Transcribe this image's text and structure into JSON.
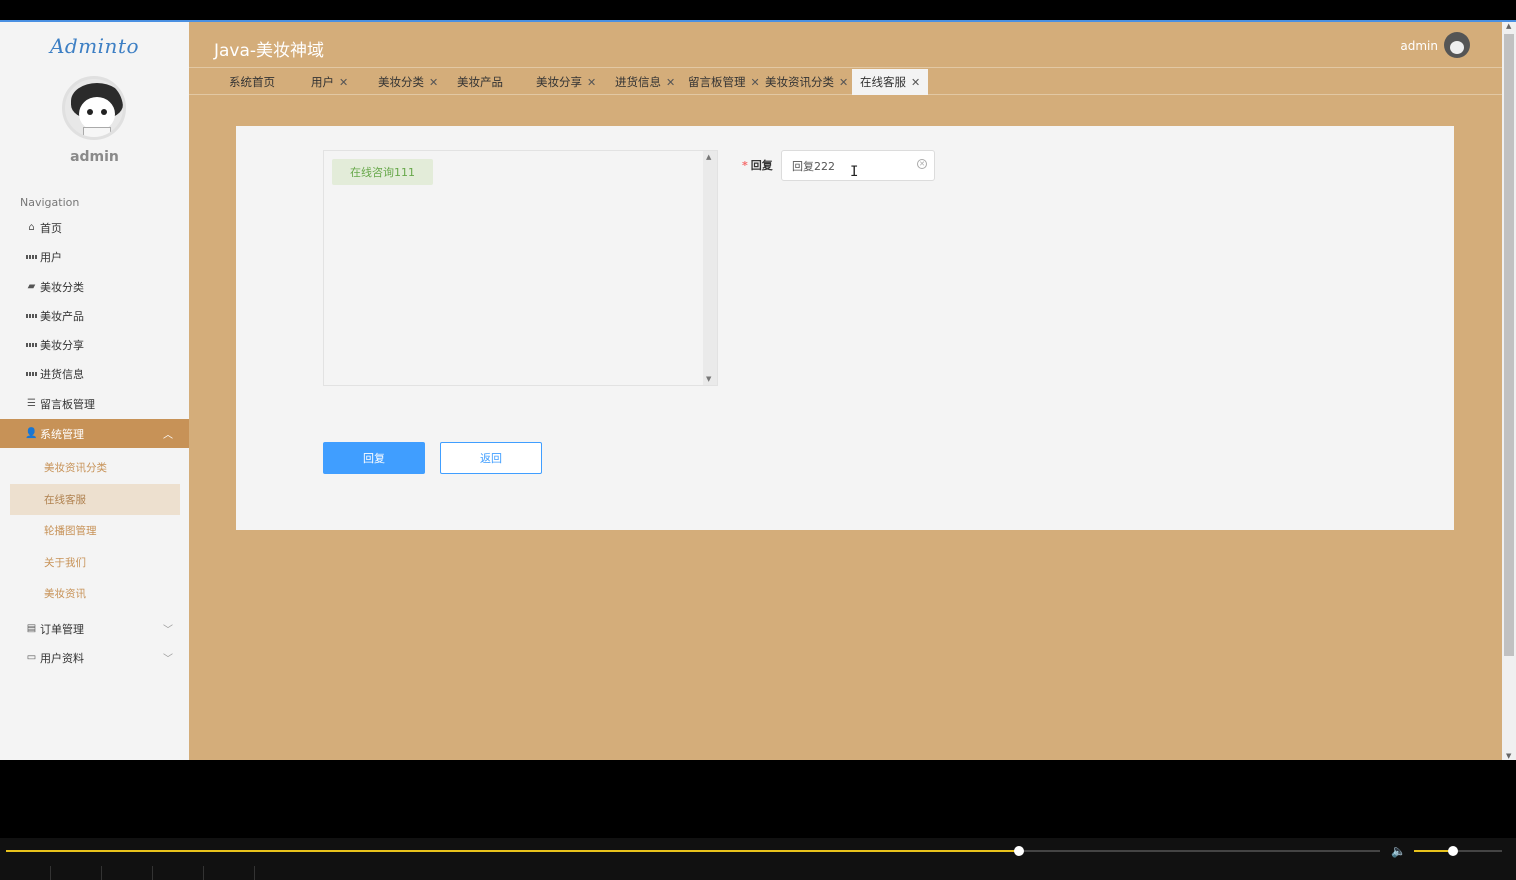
{
  "sidebar": {
    "logo": "Adminto",
    "username": "admin",
    "nav_title": "Navigation",
    "items": [
      {
        "label": "首页",
        "icon": "home-icon"
      },
      {
        "label": "用户",
        "icon": "grid-icon"
      },
      {
        "label": "美妆分类",
        "icon": "briefcase-icon"
      },
      {
        "label": "美妆产品",
        "icon": "grid-icon"
      },
      {
        "label": "美妆分享",
        "icon": "grid-icon"
      },
      {
        "label": "进货信息",
        "icon": "grid-icon"
      },
      {
        "label": "留言板管理",
        "icon": "sliders-icon"
      },
      {
        "label": "系统管理",
        "icon": "user-icon",
        "expanded": true
      }
    ],
    "subitems": [
      {
        "label": "美妆资讯分类"
      },
      {
        "label": "在线客服",
        "active": true
      },
      {
        "label": "轮播图管理"
      },
      {
        "label": "关于我们"
      },
      {
        "label": "美妆资讯"
      }
    ],
    "bottom_items": [
      {
        "label": "订单管理",
        "icon": "clipboard-icon"
      },
      {
        "label": "用户资料",
        "icon": "calendar-icon"
      }
    ]
  },
  "header": {
    "title": "Java-美妆神域",
    "user": "admin"
  },
  "tabs": [
    {
      "label": "系统首页",
      "closable": false
    },
    {
      "label": "用户",
      "closable": true
    },
    {
      "label": "美妆分类",
      "closable": true
    },
    {
      "label": "美妆产品",
      "closable": false
    },
    {
      "label": "美妆分享",
      "closable": true
    },
    {
      "label": "进货信息",
      "closable": true
    },
    {
      "label": "留言板管理",
      "closable": true
    },
    {
      "label": "美妆资讯分类",
      "closable": true
    },
    {
      "label": "在线客服",
      "closable": true,
      "active": true
    }
  ],
  "chat": {
    "messages": [
      "在线咨询111"
    ]
  },
  "form": {
    "reply_label": "回复",
    "reply_required_mark": "*",
    "reply_value": "回复222",
    "submit_label": "回复",
    "back_label": "返回"
  },
  "player": {
    "progress": 0.737,
    "volume": 0.44
  },
  "colors": {
    "main_bg": "#d4ad7a",
    "active_nav": "#c79257",
    "primary": "#409eff",
    "seek": "#e8c21c"
  }
}
